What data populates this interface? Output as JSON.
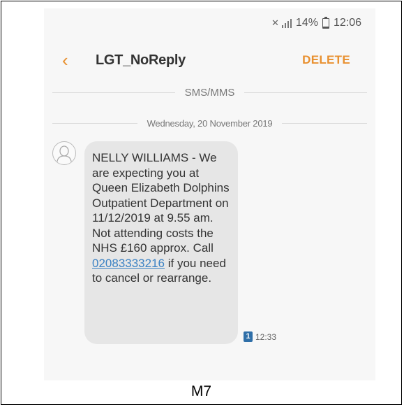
{
  "status_bar": {
    "battery": "14%",
    "time": "12:06"
  },
  "header": {
    "contact": "LGT_NoReply",
    "delete_label": "DELETE"
  },
  "thread": {
    "channel_label": "SMS/MMS",
    "date_label": "Wednesday, 20 November 2019"
  },
  "message": {
    "text_before": "NELLY WILLIAMS - We are expecting you at Queen Elizabeth Dolphins Outpatient Department on 11/12/2019 at 9.55 am. Not attending costs the NHS £160 approx. Call ",
    "phone": "02083333216",
    "text_after": " if you need to cancel or rearrange.",
    "sim": "1",
    "time": "12:33"
  },
  "caption": "M7",
  "colors": {
    "accent": "#e8902f",
    "link": "#3b82c4",
    "bubble": "#e6e6e6",
    "sim_badge": "#2f6fa8"
  }
}
